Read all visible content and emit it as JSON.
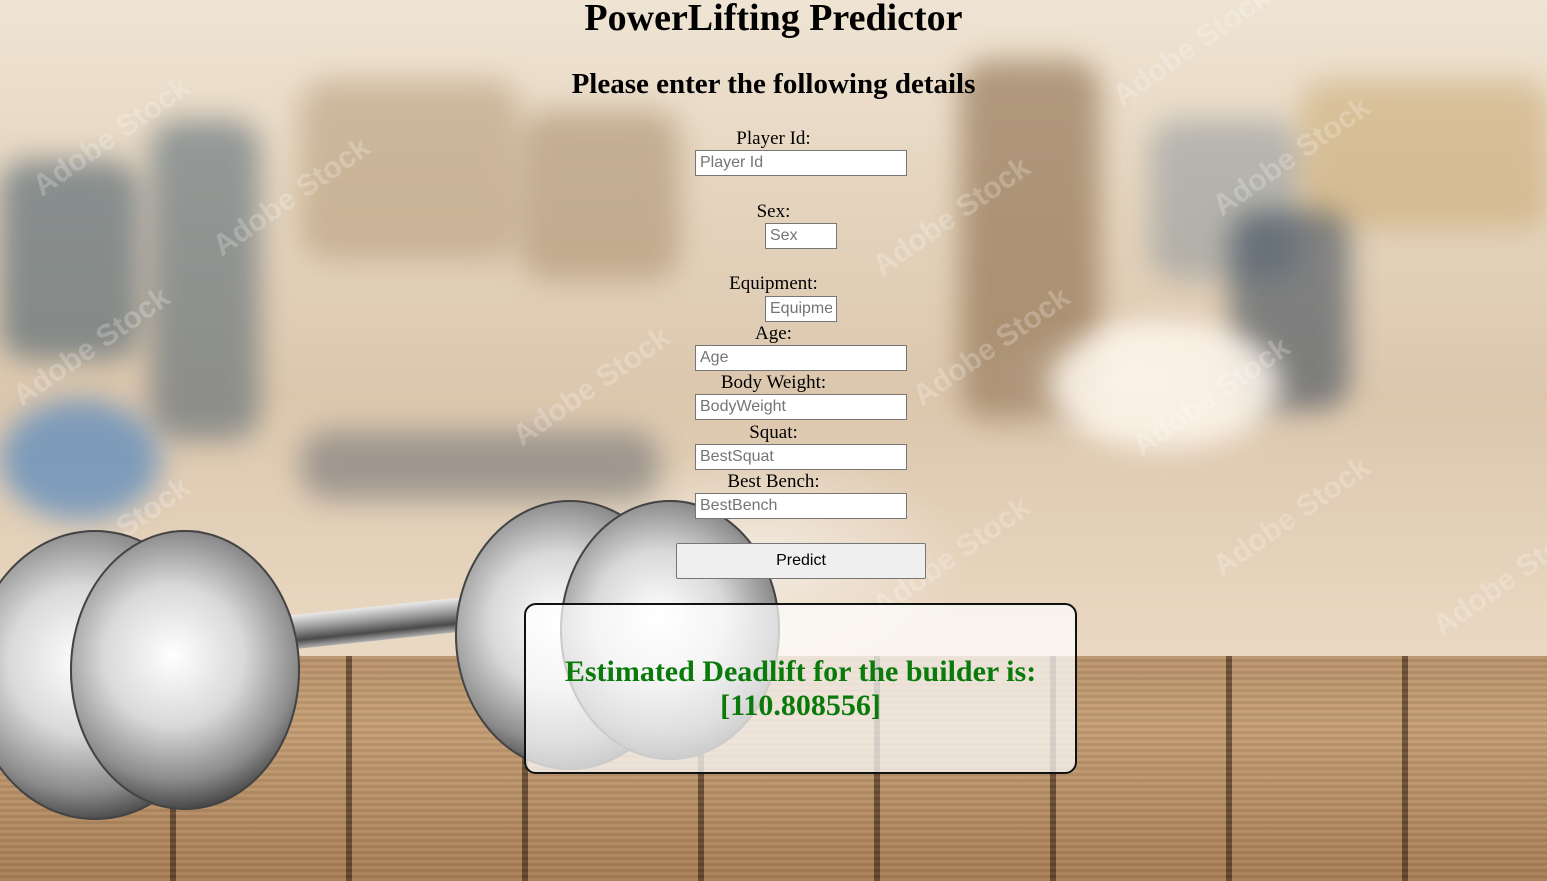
{
  "page": {
    "title": "PowerLifting Predictor",
    "subtitle": "Please enter the following details"
  },
  "form": {
    "fields": [
      {
        "label": "Player Id:",
        "placeholder": "Player Id",
        "value": ""
      },
      {
        "label": "Sex:",
        "placeholder": "Sex",
        "value": ""
      },
      {
        "label": "Equipment:",
        "placeholder": "Equipment",
        "value": ""
      },
      {
        "label": "Age:",
        "placeholder": "Age",
        "value": ""
      },
      {
        "label": "Body Weight:",
        "placeholder": "BodyWeight",
        "value": ""
      },
      {
        "label": "Squat:",
        "placeholder": "BestSquat",
        "value": ""
      },
      {
        "label": "Best Bench:",
        "placeholder": "BestBench",
        "value": ""
      }
    ],
    "submit_label": "Predict"
  },
  "result": {
    "line1": "Estimated Deadlift for the builder is:",
    "line2": "[110.808556]",
    "color": "#0a7a0a"
  },
  "background": {
    "watermark": "Adobe Stock"
  }
}
